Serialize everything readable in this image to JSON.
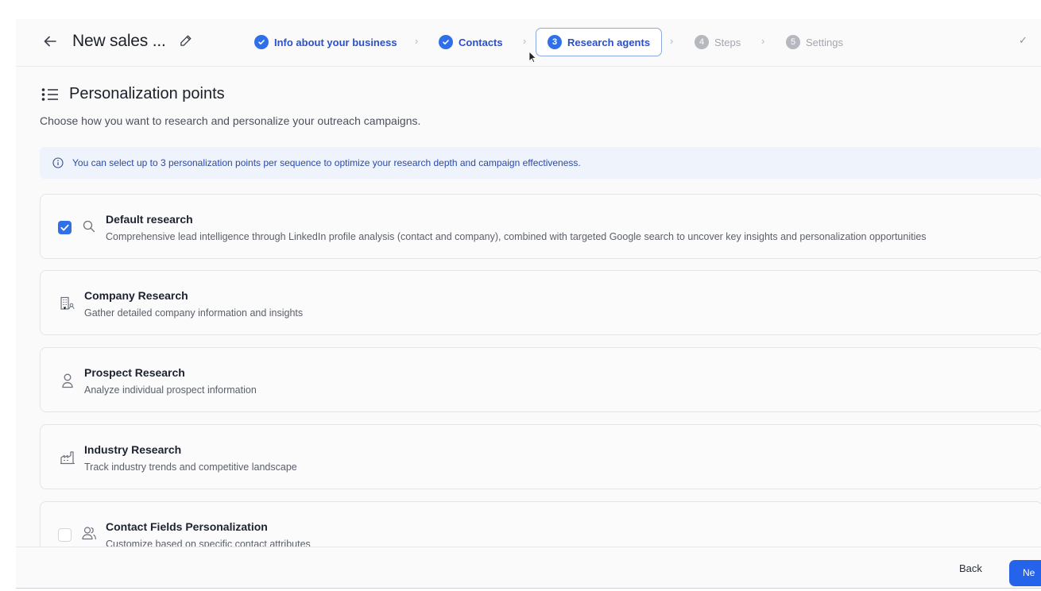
{
  "header": {
    "back_icon": "arrow-left-icon",
    "title": "New sales ...",
    "edit_icon": "pencil-icon",
    "steps": [
      {
        "number": "1",
        "label": "Info about your business",
        "state": "done"
      },
      {
        "number": "2",
        "label": "Contacts",
        "state": "done"
      },
      {
        "number": "3",
        "label": "Research agents",
        "state": "active"
      },
      {
        "number": "4",
        "label": "Steps",
        "state": "todo"
      },
      {
        "number": "5",
        "label": "Settings",
        "state": "todo"
      }
    ],
    "chevron": "›",
    "done_check": "✓"
  },
  "main": {
    "title": "Personalization points",
    "subtitle": "Choose how you want to research and personalize your outreach campaigns.",
    "info": "You can select up to 3 personalization points per sequence to optimize your research depth and campaign effectiveness.",
    "cards": [
      {
        "title": "Default research",
        "description": "Comprehensive lead intelligence through LinkedIn profile analysis (contact and company), combined with targeted Google search to uncover key insights and personalization opportunities",
        "icon": "search-icon",
        "checked": true
      },
      {
        "title": "Company Research",
        "description": "Gather detailed company information and insights",
        "icon": "building-icon",
        "checked": false
      },
      {
        "title": "Prospect Research",
        "description": "Analyze individual prospect information",
        "icon": "user-icon",
        "checked": false
      },
      {
        "title": "Industry Research",
        "description": "Track industry trends and competitive landscape",
        "icon": "factory-icon",
        "checked": false
      },
      {
        "title": "Contact Fields Personalization",
        "description": "Customize based on specific contact attributes",
        "icon": "users-icon",
        "checked": false
      }
    ]
  },
  "footer": {
    "back_label": "Back",
    "next_label": "Ne"
  },
  "colors": {
    "accent": "#2f6fe8",
    "info_bg": "#eef3fc",
    "info_text": "#2a4aa8"
  }
}
